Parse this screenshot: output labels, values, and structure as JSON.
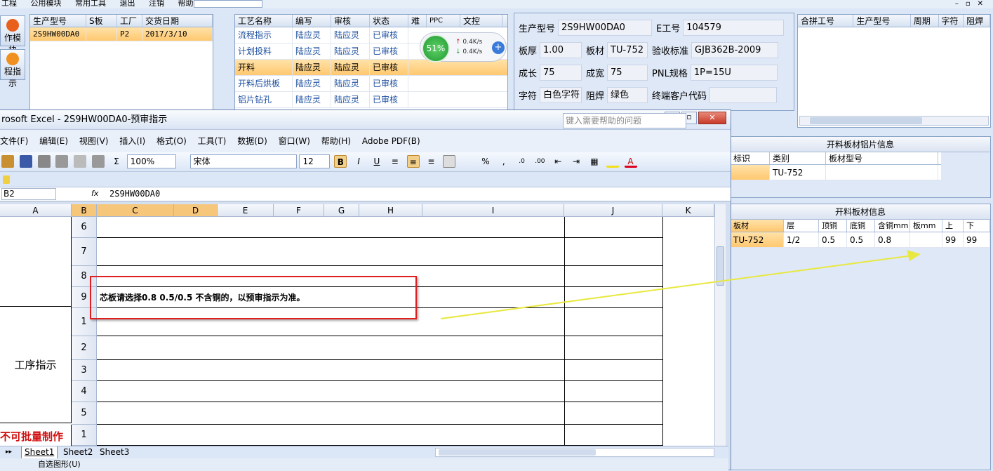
{
  "menubar": [
    "工程",
    "公用模块",
    "常用工具",
    "退出",
    "注销",
    "帮助"
  ],
  "left_nav": [
    {
      "label": "作模块"
    },
    {
      "label": "程指示"
    }
  ],
  "model_table": {
    "headers": [
      "生产型号",
      "S板",
      "工厂",
      "交货日期"
    ],
    "rows": [
      [
        "2S9HW00DA0",
        "",
        "P2",
        "2017/3/10"
      ]
    ]
  },
  "process_table": {
    "headers": [
      "工艺名称",
      "编写",
      "审核",
      "状态",
      "难",
      "PPC",
      "文控"
    ],
    "rows": [
      [
        "流程指示",
        "陆应灵",
        "陆应灵",
        "已审核"
      ],
      [
        "计划投料",
        "陆应灵",
        "陆应灵",
        "已审核"
      ],
      [
        "开料",
        "陆应灵",
        "陆应灵",
        "已审核"
      ],
      [
        "开料后烘板",
        "陆应灵",
        "陆应灵",
        "已审核"
      ],
      [
        "铝片钻孔",
        "陆应灵",
        "陆应灵",
        "已审核"
      ]
    ]
  },
  "net_widget": {
    "percent": "51%",
    "up": "0.4K/s",
    "down": "0.4K/s"
  },
  "info": {
    "model_label": "生产型号",
    "model": "2S9HW00DA0",
    "e_label": "E工号",
    "e": "104579",
    "thick_label": "板厚",
    "thick": "1.00",
    "mat_label": "板材",
    "mat": "TU-752",
    "std_label": "验收标准",
    "std": "GJB362B-2009",
    "len_label": "成长",
    "len": "75",
    "wid_label": "成宽",
    "wid": "75",
    "pnl_label": "PNL规格",
    "pnl": "1P=15U",
    "char_label": "字符",
    "char": "白色字符",
    "mask_label": "阻焊",
    "mask": "绿色",
    "cust_label": "终端客户代码",
    "cust": ""
  },
  "panel_table": {
    "headers": [
      "合拼工号",
      "生产型号",
      "周期",
      "字符",
      "阻焊"
    ]
  },
  "al_info": {
    "title": "开料板材铝片信息",
    "headers": [
      "标识",
      "类别",
      "板材型号"
    ],
    "row": [
      "",
      "TU-752",
      ""
    ]
  },
  "mat_info": {
    "title": "开料板材信息",
    "headers": [
      "板材",
      "层",
      "顶铜",
      "底铜",
      "含铜mm",
      "板mm",
      "上",
      "下"
    ],
    "row": [
      "TU-752",
      "1/2",
      "0.5",
      "0.5",
      "0.8",
      "",
      "99",
      "99"
    ]
  },
  "excel": {
    "title": "rosoft Excel - 2S9HW00DA0-预审指示",
    "menu": [
      "文件(F)",
      "编辑(E)",
      "视图(V)",
      "插入(I)",
      "格式(O)",
      "工具(T)",
      "数据(D)",
      "窗口(W)",
      "帮助(H)",
      "Adobe PDF(B)"
    ],
    "help_placeholder": "键入需要帮助的问题",
    "zoom": "100%",
    "font": "宋体",
    "size": "12",
    "cell_ref": "B2",
    "fx": "fx",
    "formula": "2S9HW00DA0",
    "cols": [
      "A",
      "B",
      "C",
      "D",
      "E",
      "F",
      "G",
      "H",
      "I",
      "J",
      "K"
    ],
    "row_nums": [
      "6",
      "7",
      "8",
      "9",
      "1",
      "2",
      "3",
      "4",
      "5",
      "1"
    ],
    "note": "芯板请选择0.8 0.5/0.5 不含铜的，以预审指示为准。",
    "section_label": "工序指示",
    "red_label": "不可批量制作",
    "sheets": [
      "Sheet1",
      "Sheet2",
      "Sheet3"
    ],
    "draw_label": "自选图形(U)"
  },
  "colors": {
    "accent": "#ffc870",
    "annotation_box": "#e02020",
    "arrow": "#f0f040",
    "red_text": "#d01010"
  }
}
